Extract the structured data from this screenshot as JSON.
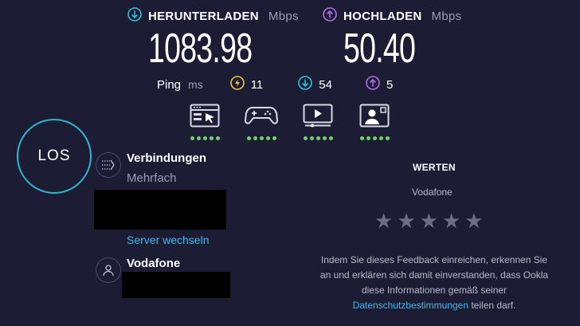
{
  "download": {
    "label": "HERUNTERLADEN",
    "unit": "Mbps",
    "value": "1083.98"
  },
  "upload": {
    "label": "HOCHLADEN",
    "unit": "Mbps",
    "value": "50.40"
  },
  "ping": {
    "label": "Ping",
    "unit": "ms",
    "idle": "11",
    "download": "54",
    "upload": "5"
  },
  "go_button": {
    "label": "LOS"
  },
  "connections": {
    "title": "Verbindungen",
    "mode": "Mehrfach",
    "change_server": "Server wechseln"
  },
  "provider": {
    "name": "Vodafone"
  },
  "rate": {
    "title": "WERTEN",
    "provider": "Vodafone",
    "stars": 5,
    "feedback_line1": "Indem Sie dieses Feedback einreichen, erkennen Sie",
    "feedback_line2": "an und erklären sich damit einverstanden, dass Ookla",
    "feedback_line3": "diese Informationen gemäß seiner",
    "privacy_link": "Datenschutzbestimmungen",
    "feedback_tail": " teilen darf."
  },
  "colors": {
    "background": "#1c1d34",
    "download": "#2fc1d9",
    "upload": "#b36ee6",
    "ping_idle": "#e8c93a",
    "ok_dot": "#6ed36a",
    "link": "#3fb7ee"
  },
  "icons": [
    "download-arrow-icon",
    "upload-arrow-icon",
    "ping-idle-icon",
    "browsing-icon",
    "gaming-icon",
    "streaming-icon",
    "video-call-icon",
    "connections-icon",
    "user-icon",
    "star-icon"
  ]
}
